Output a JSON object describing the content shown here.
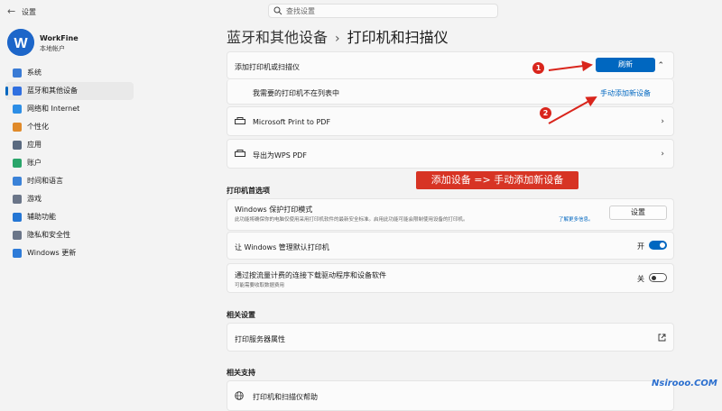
{
  "window": {
    "title": "设置",
    "back_glyph": "←"
  },
  "search": {
    "placeholder": "查找设置"
  },
  "profile": {
    "name": "WorkFine",
    "subtitle": "本地帐户",
    "logo_letter": "W"
  },
  "sidebar": {
    "items": [
      {
        "label": "系统",
        "icon": "monitor-icon",
        "color": "#3a7bd5"
      },
      {
        "label": "蓝牙和其他设备",
        "icon": "bluetooth-icon",
        "color": "#2f6fe0",
        "active": true
      },
      {
        "label": "网络和 Internet",
        "icon": "wifi-icon",
        "color": "#2d8ee6"
      },
      {
        "label": "个性化",
        "icon": "brush-icon",
        "color": "#e08a2a"
      },
      {
        "label": "应用",
        "icon": "apps-icon",
        "color": "#5a6a80"
      },
      {
        "label": "账户",
        "icon": "person-icon",
        "color": "#2aa56a"
      },
      {
        "label": "时间和语言",
        "icon": "globe-icon",
        "color": "#3a82d8"
      },
      {
        "label": "游戏",
        "icon": "gamepad-icon",
        "color": "#6a7588"
      },
      {
        "label": "辅助功能",
        "icon": "accessibility-icon",
        "color": "#2476d4"
      },
      {
        "label": "隐私和安全性",
        "icon": "shield-icon",
        "color": "#6a7588"
      },
      {
        "label": "Windows 更新",
        "icon": "update-icon",
        "color": "#2e7bd8"
      }
    ]
  },
  "breadcrumb": {
    "parent": "蓝牙和其他设备",
    "separator": "›",
    "current": "打印机和扫描仪"
  },
  "add_printer": {
    "label": "添加打印机或扫描仪",
    "refresh_button": "刷新",
    "not_listed": "我需要的打印机不在列表中",
    "manual_add_link": "手动添加新设备"
  },
  "printers": [
    {
      "name": "Microsoft Print to PDF"
    },
    {
      "name": "导出为WPS PDF"
    }
  ],
  "preferences": {
    "section_title": "打印机首选项",
    "protected_mode": {
      "title": "Windows 保护打印模式",
      "description": "此功能将确保你的电脑仅使用采用打印机软件的最新安全标准。启用此功能可能会限制使用设备的打印机。",
      "learn_more": "了解更多信息。",
      "button": "设置"
    },
    "default_printer": {
      "label": "让 Windows 管理默认打印机",
      "state_text": "开",
      "on": true
    },
    "metered": {
      "label": "通过按流量计费的连接下载驱动程序和设备软件",
      "description": "可能需要收取数据费用",
      "state_text": "关",
      "on": false
    }
  },
  "related_settings": {
    "section_title": "相关设置",
    "print_server": "打印服务器属性"
  },
  "related_support": {
    "section_title": "相关支持",
    "help": "打印机和扫描仪帮助"
  },
  "annotations": {
    "step1": "1",
    "step2": "2",
    "callout": "添加设备 => 手动添加新设备",
    "color": "#d73424"
  },
  "watermark": "Nsirooo.COM"
}
